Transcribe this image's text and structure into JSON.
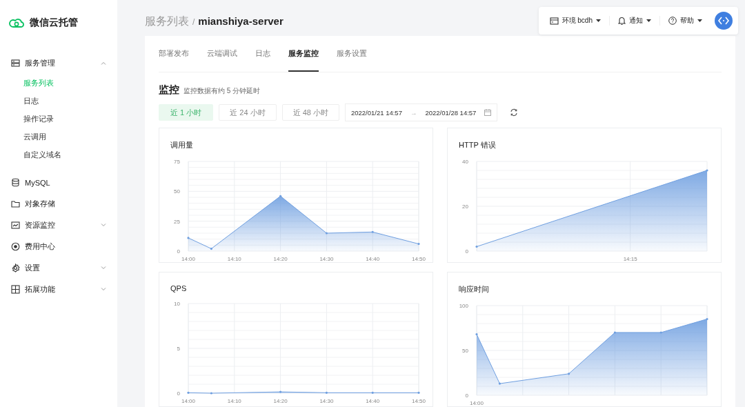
{
  "sidebar": {
    "logo": "微信云托管",
    "items": [
      {
        "label": "服务管理",
        "expanded": true,
        "children": [
          {
            "label": "服务列表",
            "selected": true
          },
          {
            "label": "日志",
            "selected": false
          },
          {
            "label": "操作记录",
            "selected": false
          },
          {
            "label": "云调用",
            "selected": false
          },
          {
            "label": "自定义域名",
            "selected": false
          }
        ]
      },
      {
        "label": "MySQL"
      },
      {
        "label": "对象存储"
      },
      {
        "label": "资源监控",
        "expanded": false
      },
      {
        "label": "费用中心"
      },
      {
        "label": "设置",
        "expanded": false
      },
      {
        "label": "拓展功能",
        "expanded": false
      }
    ]
  },
  "breadcrumb": {
    "parent": "服务列表",
    "separator": "/",
    "current": "mianshiya-server"
  },
  "toolbar": {
    "environment": "环境 bcdh",
    "notifications": "通知",
    "help": "帮助"
  },
  "tabs": [
    {
      "label": "部署发布",
      "selected": false
    },
    {
      "label": "云端调试",
      "selected": false
    },
    {
      "label": "日志",
      "selected": false
    },
    {
      "label": "服务监控",
      "selected": true
    },
    {
      "label": "服务设置",
      "selected": false
    }
  ],
  "section": {
    "title": "监控",
    "note": "监控数据有约 5 分钟延时"
  },
  "ranges": [
    {
      "label": "近 1 小时",
      "selected": true
    },
    {
      "label": "近 24 小时",
      "selected": false
    },
    {
      "label": "近 48 小时",
      "selected": false
    }
  ],
  "date_range": {
    "start": "2022/01/21 14:57",
    "separator": "→",
    "end": "2022/01/28 14:57"
  },
  "charts": [
    {
      "title": "调用量",
      "chart_data": {
        "type": "area",
        "categories": [
          "14:00",
          null,
          "14:10",
          null,
          "14:20",
          null,
          "14:30",
          null,
          "14:40",
          null,
          "14:50"
        ],
        "grid": true,
        "series": [
          {
            "color": "#6f9fe0",
            "values": [
              11,
              2,
              null,
              null,
              46,
              null,
              15,
              null,
              16,
              null,
              6
            ]
          }
        ],
        "ylim": [
          0,
          75
        ],
        "yticks": [
          0,
          25,
          50,
          75
        ]
      }
    },
    {
      "title": "HTTP 错误",
      "chart_data": {
        "type": "area",
        "categories": [
          null,
          null,
          "14:15",
          null
        ],
        "grid": true,
        "series": [
          {
            "color": "#6f9fe0",
            "values": [
              2,
              null,
              null,
              36
            ]
          }
        ],
        "ylim": [
          0,
          40
        ],
        "yticks": [
          0,
          20,
          40
        ]
      }
    },
    {
      "title": "QPS",
      "chart_data": {
        "type": "area",
        "categories": [
          "14:00",
          null,
          "14:10",
          null,
          "14:20",
          null,
          "14:30",
          null,
          "14:40",
          null,
          "14:50"
        ],
        "grid": true,
        "series": [
          {
            "color": "#6f9fe0",
            "values": [
              0.05,
              0,
              null,
              null,
              0.15,
              null,
              0.05,
              null,
              0.05,
              null,
              0.05
            ]
          }
        ],
        "ylim": [
          0,
          10
        ],
        "yticks": [
          0,
          5,
          10
        ]
      }
    },
    {
      "title": "响应时间",
      "chart_data": {
        "type": "area",
        "categories": [
          "14:00",
          null,
          null,
          null,
          null,
          null,
          null,
          null,
          null,
          null,
          null
        ],
        "grid": true,
        "series": [
          {
            "color": "#6f9fe0",
            "values": [
              68,
              13,
              null,
              null,
              24,
              null,
              70,
              null,
              70,
              null,
              85
            ]
          }
        ],
        "ylim": [
          0,
          100
        ],
        "yticks": [
          0,
          50,
          100
        ]
      }
    }
  ]
}
